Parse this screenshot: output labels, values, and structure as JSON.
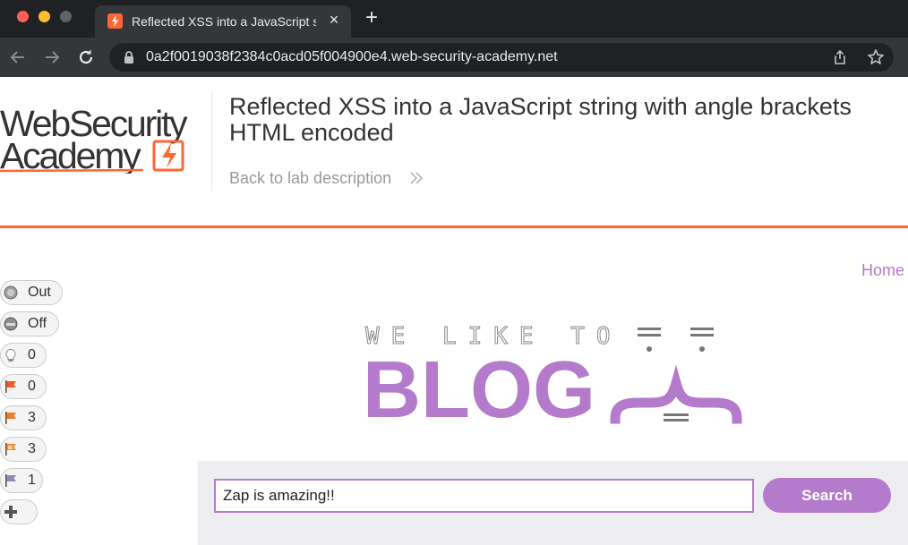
{
  "browser": {
    "tab_title": "Reflected XSS into a JavaScript string with angle brackets HTML encoded",
    "url": "0a2f0019038f2384c0acd05f004900e4.web-security-academy.net"
  },
  "colors": {
    "accent_orange": "#ff6633",
    "accent_purple": "#b47acb",
    "chrome_dark": "#202124",
    "chrome_toolbar": "#35363a"
  },
  "logo": {
    "line1": "WebSecurity",
    "line2": "Academy"
  },
  "lab": {
    "title": "Reflected XSS into a JavaScript string with angle brackets HTML encoded",
    "back_link": "Back to lab description"
  },
  "nav": {
    "home": "Home"
  },
  "sidebar": [
    {
      "icon": "globe-icon",
      "label": "Out"
    },
    {
      "icon": "power-icon",
      "label": "Off"
    },
    {
      "icon": "lightbulb-icon",
      "label": "0"
    },
    {
      "icon": "red-flag-icon",
      "label": "0"
    },
    {
      "icon": "orange-flag-icon",
      "label": "3"
    },
    {
      "icon": "yellow-flag-icon",
      "label": "3"
    },
    {
      "icon": "blue-flag-icon",
      "label": "1"
    },
    {
      "icon": "plus-icon",
      "label": ""
    }
  ],
  "banner": {
    "tagline": "WE LIKE TO",
    "word": "BLOG"
  },
  "search": {
    "value": "Zap is amazing!!",
    "button": "Search"
  }
}
